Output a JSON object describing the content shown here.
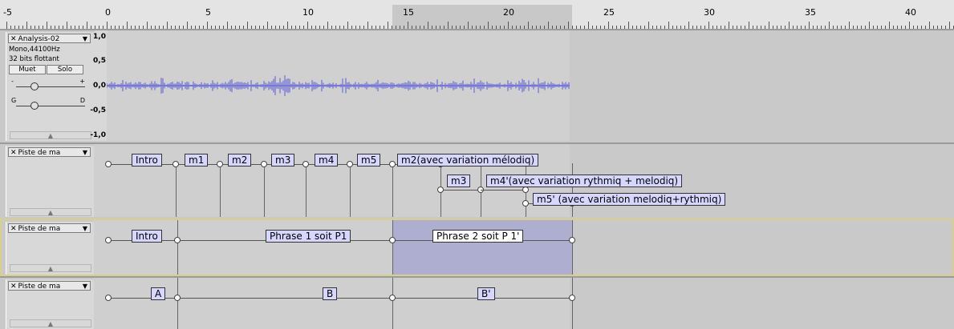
{
  "ruler": {
    "ticks": [
      "-5",
      "0",
      "5",
      "10",
      "15",
      "20",
      "25",
      "30",
      "35",
      "40"
    ]
  },
  "track1": {
    "name": "Analysis-02",
    "format": "Mono,44100Hz",
    "bits": "32 bits flottant",
    "mute_label": "Muet",
    "solo_label": "Solo",
    "gain_minus": "-",
    "gain_plus": "+",
    "pan_left": "G",
    "pan_right": "D",
    "amp": [
      "1,0",
      "0,5",
      "0,0",
      "-0,5",
      "-1,0"
    ],
    "wave_color": "#5a5ad8"
  },
  "track2": {
    "name": "Piste de ma",
    "labels": [
      "Intro",
      "m1",
      "m2",
      "m3",
      "m4",
      "m5",
      "m2(avec variation mélodiq)",
      "m3",
      "m4'(avec variation rythmiq + melodiq)",
      "m5' (avec variation melodiq+rythmiq)"
    ]
  },
  "track3": {
    "name": "Piste de ma",
    "labels": [
      "Intro",
      "Phrase 1 soit P1",
      "Phrase 2 soit P 1'"
    ]
  },
  "track4": {
    "name": "Piste de ma",
    "labels": [
      "A",
      "B",
      "B'"
    ]
  },
  "icons": {
    "close": "close-icon",
    "menu": "dropdown-arrow-icon",
    "collapse": "collapse-arrow-icon"
  }
}
